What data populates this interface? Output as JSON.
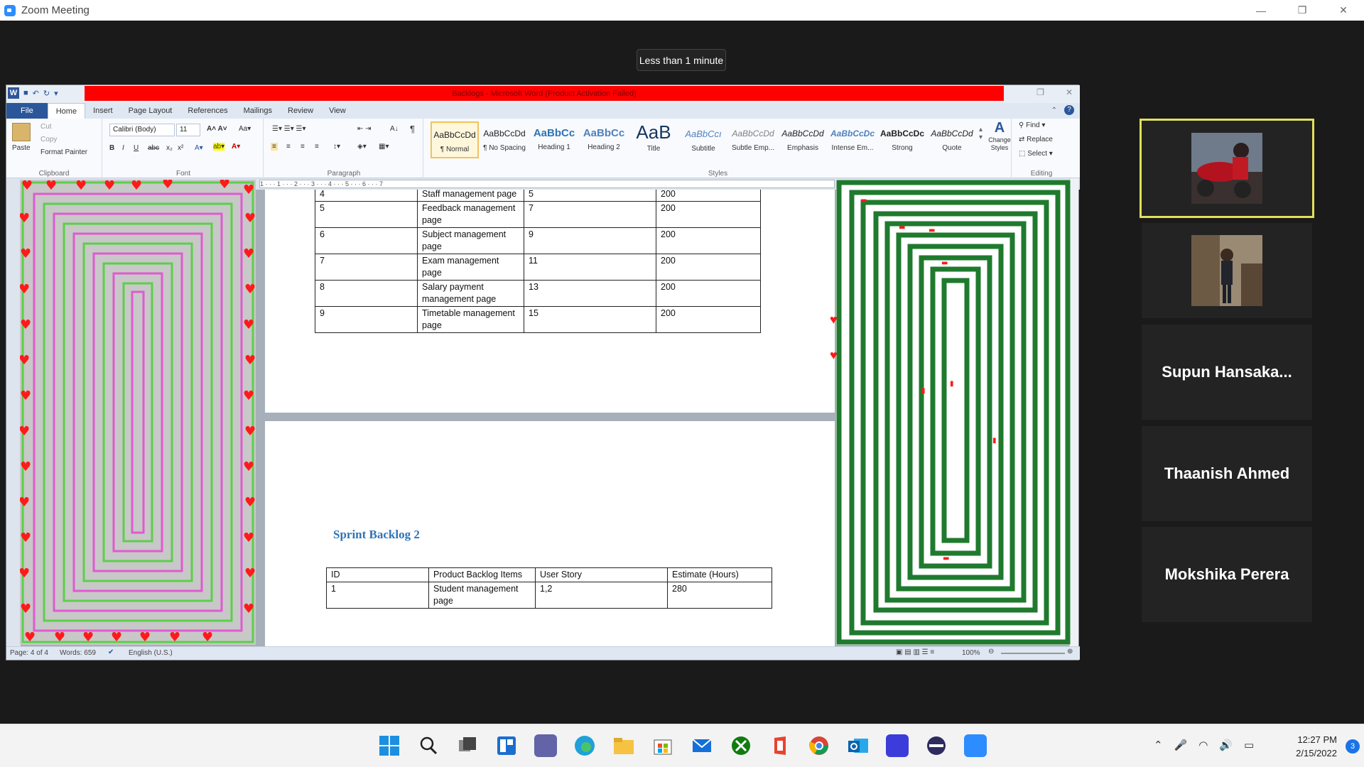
{
  "zoom": {
    "title": "Zoom Meeting",
    "timer": "Less than 1 minute",
    "minimize": "—",
    "restore": "❐",
    "close": "✕"
  },
  "word": {
    "title": "Backlogs - Microsoft Word (Product Activation Failed)",
    "tabs": [
      "File",
      "Home",
      "Insert",
      "Page Layout",
      "References",
      "Mailings",
      "Review",
      "View"
    ],
    "clipboard": {
      "paste": "Paste",
      "cut": "Cut",
      "copy": "Copy",
      "format_painter": "Format Painter",
      "label": "Clipboard"
    },
    "font": {
      "name": "Calibri (Body)",
      "size": "11",
      "label": "Font"
    },
    "paragraph_label": "Paragraph",
    "styles": [
      {
        "sample": "AaBbCcDd",
        "label": "¶ Normal"
      },
      {
        "sample": "AaBbCcDd",
        "label": "¶ No Spacing"
      },
      {
        "sample": "AaBbCc",
        "label": "Heading 1"
      },
      {
        "sample": "AaBbCc",
        "label": "Heading 2"
      },
      {
        "sample": "AaB",
        "label": "Title"
      },
      {
        "sample": "AaBbCcı",
        "label": "Subtitle"
      },
      {
        "sample": "AaBbCcDd",
        "label": "Subtle Emp..."
      },
      {
        "sample": "AaBbCcDd",
        "label": "Emphasis"
      },
      {
        "sample": "AaBbCcDc",
        "label": "Intense Em..."
      },
      {
        "sample": "AaBbCcDc",
        "label": "Strong"
      },
      {
        "sample": "AaBbCcDd",
        "label": "Quote"
      }
    ],
    "styles_label": "Styles",
    "change_styles": "Change Styles",
    "editing": {
      "find": "Find",
      "replace": "Replace",
      "select": "Select",
      "label": "Editing"
    },
    "ruler_marks": "1 · · · 1 · · · 2 · · · 3 · · · 4 · · · 5 · · · 6 · · · 7",
    "table1": [
      [
        "4",
        "Staff management page",
        "5",
        "200"
      ],
      [
        "5",
        "Feedback management page",
        "7",
        "200"
      ],
      [
        "6",
        "Subject management page",
        "9",
        "200"
      ],
      [
        "7",
        "Exam management page",
        "11",
        "200"
      ],
      [
        "8",
        "Salary payment management page",
        "13",
        "200"
      ],
      [
        "9",
        "Timetable management page",
        "15",
        "200"
      ]
    ],
    "heading2": "Sprint Backlog 2",
    "table2_header": [
      "ID",
      "Product Backlog Items",
      "User Story",
      "Estimate (Hours)"
    ],
    "table2_row1": [
      "1",
      "Student management page",
      "1,2",
      "280"
    ],
    "status": {
      "page": "Page: 4 of 4",
      "words": "Words: 659",
      "language": "English (U.S.)",
      "zoom": "100%"
    }
  },
  "participants": [
    {
      "name": "",
      "type": "video"
    },
    {
      "name": "",
      "type": "video"
    },
    {
      "name": "Supun  Hansaka..."
    },
    {
      "name": "Thaanish Ahmed"
    },
    {
      "name": "Mokshika Perera"
    }
  ],
  "taskbar": {
    "time": "12:27 PM",
    "date": "2/15/2022",
    "notifications": "3"
  },
  "colors": {
    "word_blue": "#2b579a",
    "red_bar": "#ff0000",
    "heading_blue": "#2e74b5",
    "active_speaker": "#e1e05a"
  }
}
